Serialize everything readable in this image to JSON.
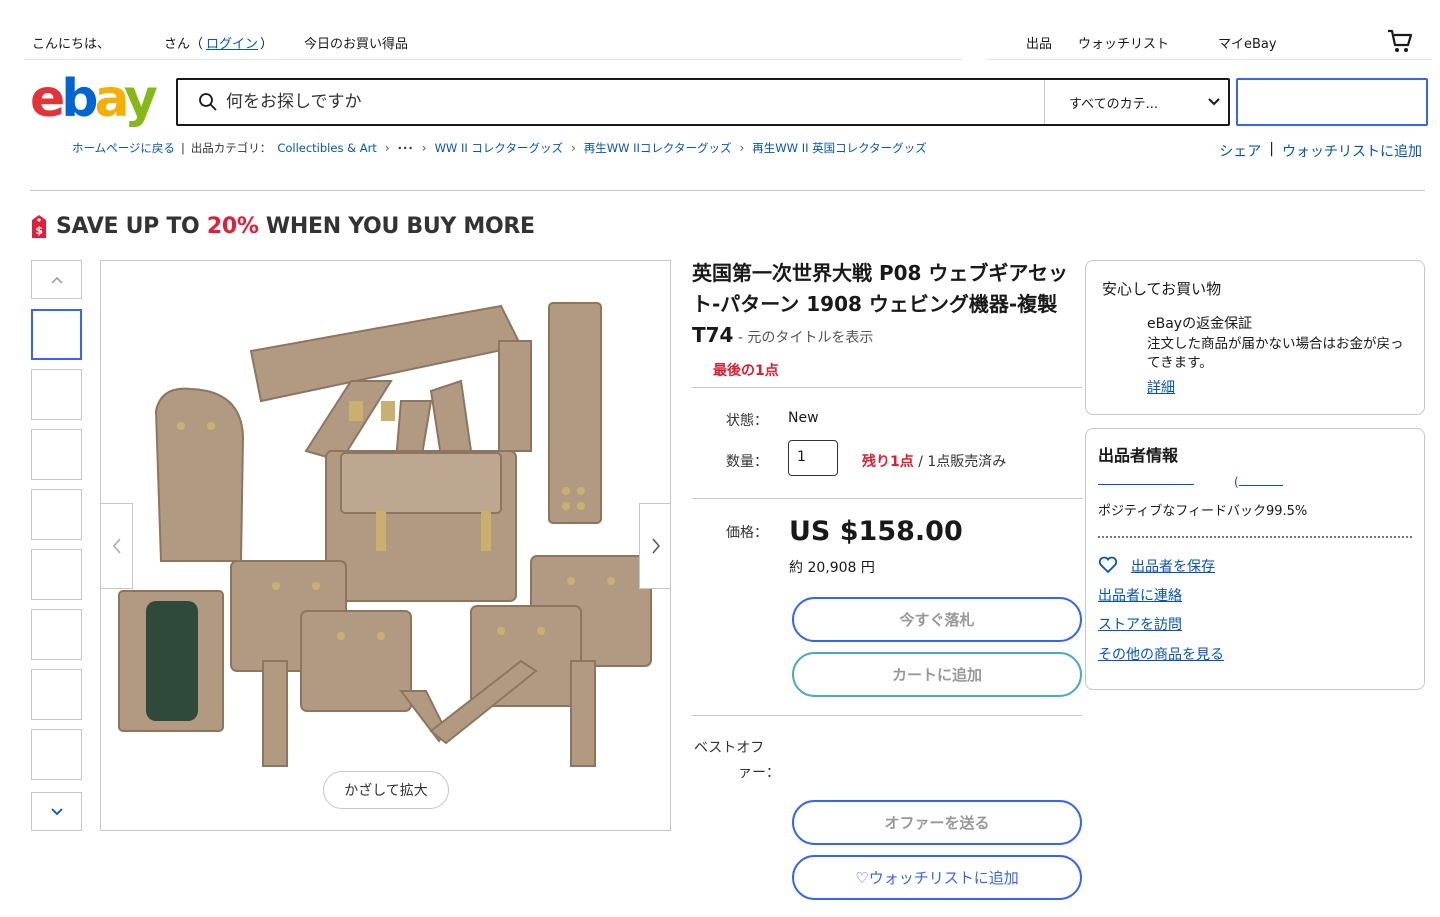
{
  "topbar": {
    "greeting": "こんにちは、",
    "san": "さん（",
    "login": "ログイン",
    "close_paren": "）",
    "deals": "今日のお買い得品",
    "sell": "出品",
    "watchlist": "ウォッチリスト",
    "my_ebay": "マイeBay"
  },
  "header": {
    "search_placeholder": "何をお探しですか",
    "category": "すべてのカテ..."
  },
  "breadcrumb": {
    "back": "ホームページに戻る",
    "listed_in": "出品カテゴリ：",
    "items": [
      "Collectibles & Art",
      "WW II コレクターグッズ",
      "再生WW IIコレクターグッズ",
      "再生WW II 英国コレクターグッズ"
    ]
  },
  "share": {
    "share": "シェア",
    "add_watchlist": "ウォッチリストに追加"
  },
  "promo": {
    "prefix": "SAVE UP TO ",
    "pct": "20%",
    "suffix": " WHEN YOU BUY MORE"
  },
  "gallery": {
    "zoom_label": "かざして拡大"
  },
  "product": {
    "title": "英国第一次世界大戦 P08 ウェブギアセット-パターン 1908 ウェビング機器-複製 T74",
    "title_orig": " - 元のタイトルを表示",
    "last_one": "最後の1点",
    "condition_label": "状態：",
    "condition_value": "New",
    "qty_label": "数量：",
    "qty_value": "1",
    "remaining": "残り1点",
    "sold": " / 1点販売済み",
    "price_label": "価格：",
    "price": "US $158.00",
    "approx": "約 20,908 円",
    "buy_now": "今すぐ落札",
    "add_cart": "カートに追加",
    "best_offer_label_1": "ベストオフ",
    "best_offer_label_2": "ァー：",
    "send_offer": "オファーを送る",
    "add_watchlist": "♡ウォッチリストに追加"
  },
  "guarantee": {
    "heading": "安心してお買い物",
    "title": "eBayの返金保証",
    "desc": "注文した商品が届かない場合はお金が戻ってきます。",
    "more": "詳細"
  },
  "seller": {
    "heading": "出品者情報",
    "feedback": "ポジティブなフィードバック99.5%",
    "save": "出品者を保存",
    "contact": "出品者に連絡",
    "store": "ストアを訪問",
    "other": "その他の商品を見る"
  },
  "colors": {
    "accent": "#3665f3",
    "link": "#0654ba",
    "alert": "#dd1e31",
    "product": "#b29a82"
  }
}
